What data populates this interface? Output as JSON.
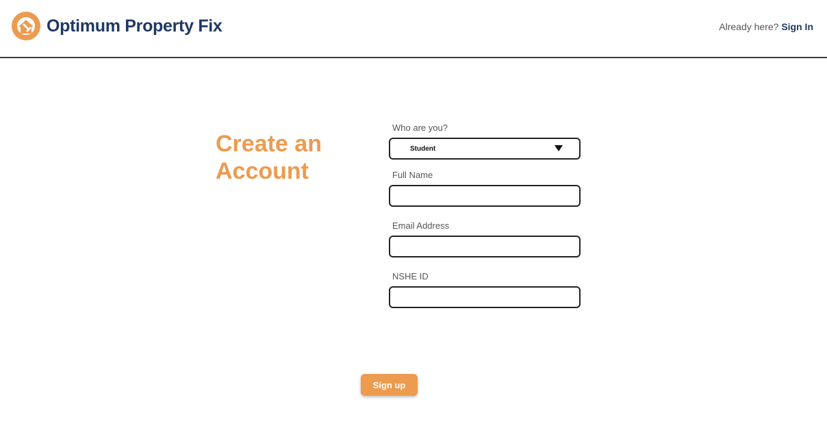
{
  "header": {
    "brand": "Optimum Property Fix",
    "already_here": "Already here?",
    "sign_in": "Sign In"
  },
  "page": {
    "title": "Create an Account"
  },
  "form": {
    "role": {
      "label": "Who are you?",
      "value": "Student"
    },
    "full_name": {
      "label": "Full Name",
      "value": ""
    },
    "email": {
      "label": "Email Address",
      "value": ""
    },
    "nshe_id": {
      "label": "NSHE ID",
      "value": ""
    }
  },
  "actions": {
    "signup": "Sign up"
  },
  "colors": {
    "accent": "#ec9b4f",
    "brand": "#1f3864",
    "border": "#222222"
  },
  "icons": {
    "logo": "house-wrench-icon",
    "dropdown": "caret-down-icon"
  }
}
